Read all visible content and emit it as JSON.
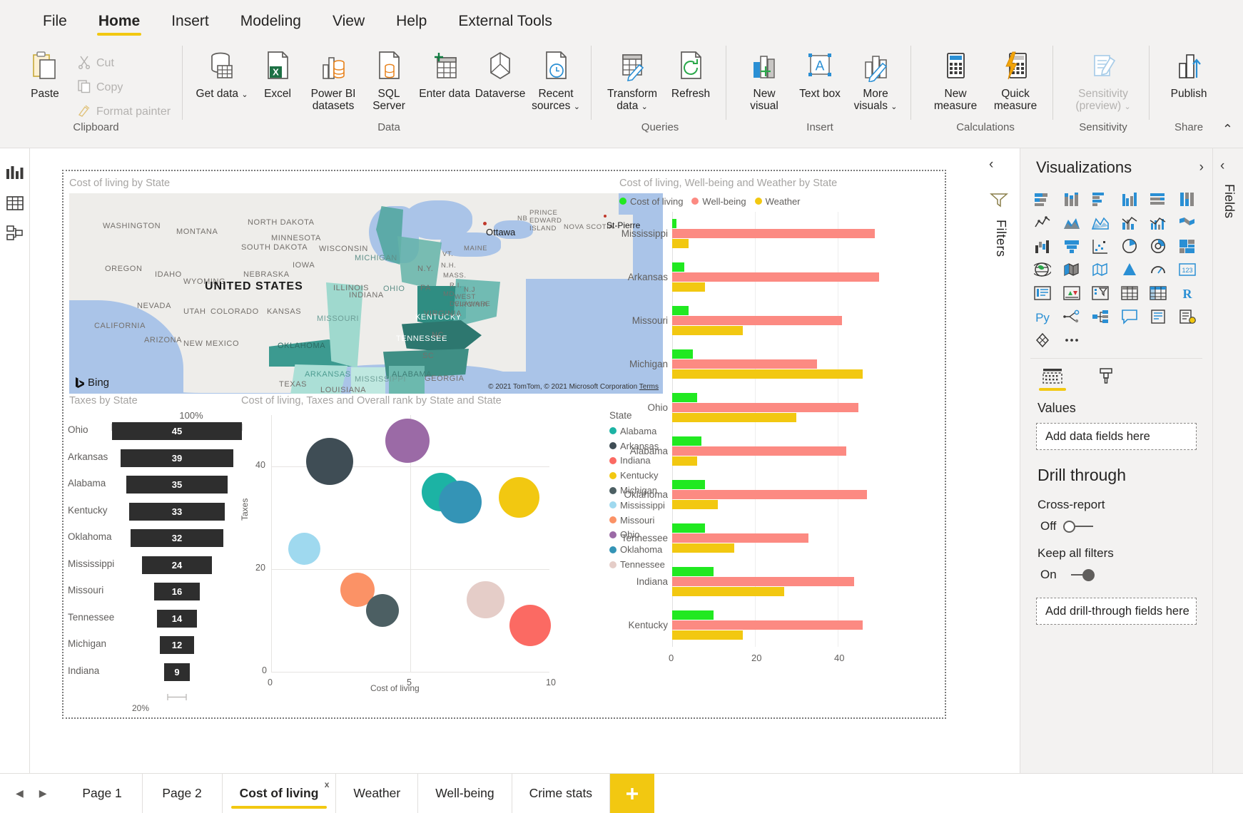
{
  "ribbon": {
    "tabs": [
      {
        "label": "File",
        "active": false
      },
      {
        "label": "Home",
        "active": true
      },
      {
        "label": "Insert",
        "active": false
      },
      {
        "label": "Modeling",
        "active": false
      },
      {
        "label": "View",
        "active": false
      },
      {
        "label": "Help",
        "active": false
      },
      {
        "label": "External Tools",
        "active": false
      }
    ],
    "groups": [
      {
        "name": "Clipboard",
        "items": [
          {
            "label": "Paste",
            "icon": "paste-icon",
            "disabled": false
          },
          {
            "label": "Cut",
            "icon": "cut-icon",
            "disabled": true
          },
          {
            "label": "Copy",
            "icon": "copy-icon",
            "disabled": true
          },
          {
            "label": "Format painter",
            "icon": "format-painter-icon",
            "disabled": true
          }
        ]
      },
      {
        "name": "Data",
        "items": [
          {
            "label": "Get data",
            "icon": "get-data-icon",
            "caret": true
          },
          {
            "label": "Excel",
            "icon": "excel-icon"
          },
          {
            "label": "Power BI datasets",
            "icon": "powerbi-datasets-icon"
          },
          {
            "label": "SQL Server",
            "icon": "sql-server-icon"
          },
          {
            "label": "Enter data",
            "icon": "enter-data-icon"
          },
          {
            "label": "Dataverse",
            "icon": "dataverse-icon"
          },
          {
            "label": "Recent sources",
            "icon": "recent-sources-icon",
            "caret": true
          }
        ]
      },
      {
        "name": "Queries",
        "items": [
          {
            "label": "Transform data",
            "icon": "transform-data-icon",
            "caret": true
          },
          {
            "label": "Refresh",
            "icon": "refresh-icon"
          }
        ]
      },
      {
        "name": "Insert",
        "items": [
          {
            "label": "New visual",
            "icon": "new-visual-icon"
          },
          {
            "label": "Text box",
            "icon": "text-box-icon"
          },
          {
            "label": "More visuals",
            "icon": "more-visuals-icon",
            "caret": true
          }
        ]
      },
      {
        "name": "Calculations",
        "items": [
          {
            "label": "New measure",
            "icon": "new-measure-icon"
          },
          {
            "label": "Quick measure",
            "icon": "quick-measure-icon"
          }
        ]
      },
      {
        "name": "Sensitivity",
        "items": [
          {
            "label": "Sensitivity (preview)",
            "icon": "sensitivity-icon",
            "caret": true,
            "disabled": true
          }
        ]
      },
      {
        "name": "Share",
        "items": [
          {
            "label": "Publish",
            "icon": "publish-icon"
          }
        ]
      }
    ],
    "collapse_icon": "chevron-up-icon"
  },
  "left_rail": [
    {
      "name": "report-view-icon"
    },
    {
      "name": "data-view-icon"
    },
    {
      "name": "model-view-icon"
    }
  ],
  "filters_pane": {
    "label": "Filters",
    "collapse_icon": "chevron-left-icon",
    "filter_icon": "filter-funnel-icon"
  },
  "fields_pane": {
    "label": "Fields",
    "collapse_icon": "chevron-left-icon"
  },
  "visualizations": {
    "title": "Visualizations",
    "collapse_icon": "chevron-right-icon",
    "icons": [
      "stacked-bar-chart-icon",
      "stacked-column-chart-icon",
      "clustered-bar-chart-icon",
      "clustered-column-chart-icon",
      "pct-stacked-bar-icon",
      "pct-stacked-column-icon",
      "line-chart-icon",
      "area-chart-icon",
      "stacked-area-chart-icon",
      "line-stacked-column-icon",
      "line-clustered-column-icon",
      "ribbon-chart-icon",
      "waterfall-chart-icon",
      "funnel-chart-icon",
      "scatter-chart-icon",
      "pie-chart-icon",
      "donut-chart-icon",
      "treemap-icon",
      "map-icon",
      "filled-map-icon",
      "shape-map-icon",
      "azure-map-icon",
      "gauge-icon",
      "card-icon",
      "multi-row-card-icon",
      "kpi-icon",
      "slicer-icon",
      "table-icon",
      "matrix-icon",
      "r-script-visual-icon",
      "python-visual-icon",
      "key-influencers-icon",
      "decomposition-tree-icon",
      "qna-icon",
      "smart-narrative-icon",
      "paginated-report-icon",
      "get-more-visuals-icon",
      "more-options-icon"
    ],
    "field_tabs": [
      {
        "name": "fields-tab-icon",
        "active": true
      },
      {
        "name": "format-paintbrush-tab-icon",
        "active": false
      }
    ],
    "values_label": "Values",
    "values_well_placeholder": "Add data fields here",
    "drill_through": {
      "title": "Drill through",
      "cross_report_label": "Cross-report",
      "cross_report_state": "Off",
      "keep_filters_label": "Keep all filters",
      "keep_filters_state": "On",
      "well_placeholder": "Add drill-through fields here"
    }
  },
  "page_tabs": {
    "prev_icon": "chevron-left-icon",
    "next_icon": "chevron-right-icon",
    "add_icon": "plus-icon",
    "tabs": [
      {
        "label": "Page 1",
        "active": false
      },
      {
        "label": "Page 2",
        "active": false
      },
      {
        "label": "Cost of living",
        "active": true,
        "close": "x"
      },
      {
        "label": "Weather",
        "active": false
      },
      {
        "label": "Well-being",
        "active": false
      },
      {
        "label": "Crime stats",
        "active": false
      }
    ]
  },
  "map_visual": {
    "title": "Cost of living by State",
    "attribution": "© 2021 TomTom, © 2021 Microsoft Corporation",
    "terms_link": "Terms",
    "provider": "Bing",
    "country_label": "UNITED STATES",
    "city_labels": [
      "Ottawa",
      "St-Pierre"
    ],
    "state_labels": [
      "WASHINGTON",
      "MONTANA",
      "NORTH DAKOTA",
      "MINNESOTA",
      "WISCONSIN",
      "MICHIGAN",
      "OREGON",
      "IDAHO",
      "WYOMING",
      "SOUTH DAKOTA",
      "IOWA",
      "NEBRASKA",
      "NEVADA",
      "UTAH",
      "COLORADO",
      "KANSAS",
      "MISSOURI",
      "ILLINOIS",
      "INDIANA",
      "OHIO",
      "PA",
      "N.Y.",
      "MASS.",
      "R.I.",
      "N.H.",
      "VT.",
      "MAINE",
      "CALIFORNIA",
      "ARIZONA",
      "NEW MEXICO",
      "OKLAHOMA",
      "ARKANSAS",
      "KENTUCKY",
      "TENNESSEE",
      "WEST VIRGINIA",
      "VIRGINIA",
      "MD",
      "DELAWARE",
      "N.J.",
      "NC",
      "SC",
      "TEXAS",
      "LOUISIANA",
      "MISSISSIPPI",
      "ALABAMA",
      "GEORGIA",
      "NB",
      "PRINCE EDWARD ISLAND",
      "NOVA SCOTIA"
    ]
  },
  "chart_data": [
    {
      "id": "funnel",
      "type": "bar",
      "title": "Taxes by State",
      "subtype": "funnel",
      "top_label": "100%",
      "bottom_label": "20%",
      "categories": [
        "Ohio",
        "Arkansas",
        "Alabama",
        "Kentucky",
        "Oklahoma",
        "Mississippi",
        "Missouri",
        "Tennessee",
        "Michigan",
        "Indiana"
      ],
      "values": [
        45,
        39,
        35,
        33,
        32,
        24,
        16,
        14,
        12,
        9
      ],
      "ylabel": "",
      "xlabel": "",
      "color": "#2e2e2e"
    },
    {
      "id": "scatter",
      "type": "scatter",
      "title": "Cost of living, Taxes and Overall rank by State and State",
      "xlabel": "Cost of living",
      "ylabel": "Taxes",
      "xlim": [
        0,
        10
      ],
      "ylim": [
        0,
        50
      ],
      "xticks": [
        0,
        5,
        10
      ],
      "yticks": [
        0,
        20,
        40
      ],
      "legend_title": "State",
      "legend_position": "right",
      "points": [
        {
          "name": "Ohio",
          "x": 4.9,
          "y": 45,
          "size": 45,
          "color": "#9b6aa6"
        },
        {
          "name": "Arkansas",
          "x": 2.1,
          "y": 41,
          "size": 50,
          "color": "#3f4d55"
        },
        {
          "name": "Alabama",
          "x": 6.1,
          "y": 35,
          "size": 37,
          "color": "#1cb3a4"
        },
        {
          "name": "Oklahoma",
          "x": 6.8,
          "y": 33,
          "size": 43,
          "color": "#3494b6"
        },
        {
          "name": "Kentucky",
          "x": 8.9,
          "y": 34,
          "size": 40,
          "color": "#f2c811"
        },
        {
          "name": "Mississippi",
          "x": 1.2,
          "y": 24,
          "size": 27,
          "color": "#9fd9ef"
        },
        {
          "name": "Missouri",
          "x": 3.1,
          "y": 16,
          "size": 30,
          "color": "#fb9266"
        },
        {
          "name": "Michigan",
          "x": 4.0,
          "y": 12,
          "size": 28,
          "color": "#4c5f63"
        },
        {
          "name": "Tennessee",
          "x": 7.7,
          "y": 14,
          "size": 35,
          "color": "#e5cdc8"
        },
        {
          "name": "Indiana",
          "x": 9.3,
          "y": 9,
          "size": 41,
          "color": "#fb6a63"
        }
      ],
      "legend": [
        {
          "label": "Alabama",
          "color": "#1cb3a4"
        },
        {
          "label": "Arkansas",
          "color": "#3f4d55"
        },
        {
          "label": "Indiana",
          "color": "#fb6a63"
        },
        {
          "label": "Kentucky",
          "color": "#f2c811"
        },
        {
          "label": "Michigan",
          "color": "#4c5f63"
        },
        {
          "label": "Mississippi",
          "color": "#9fd9ef"
        },
        {
          "label": "Missouri",
          "color": "#fb9266"
        },
        {
          "label": "Ohio",
          "color": "#9b6aa6"
        },
        {
          "label": "Oklahoma",
          "color": "#3494b6"
        },
        {
          "label": "Tennessee",
          "color": "#e5cdc8"
        }
      ]
    },
    {
      "id": "bars",
      "type": "bar",
      "title": "Cost of living, Well-being and Weather by State",
      "orientation": "horizontal",
      "xlabel": "",
      "ylabel": "",
      "xticks": [
        0,
        20,
        40
      ],
      "xlim": [
        0,
        50
      ],
      "categories": [
        "Mississippi",
        "Arkansas",
        "Missouri",
        "Michigan",
        "Ohio",
        "Alabama",
        "Oklahoma",
        "Tennessee",
        "Indiana",
        "Kentucky"
      ],
      "series": [
        {
          "name": "Cost of living",
          "color": "#21e921",
          "values": [
            1,
            3,
            4,
            5,
            6,
            7,
            8,
            8,
            10,
            10
          ]
        },
        {
          "name": "Well-being",
          "color": "#fc8a82",
          "values": [
            49,
            50,
            41,
            35,
            45,
            42,
            47,
            33,
            44,
            46
          ]
        },
        {
          "name": "Weather",
          "color": "#f2c811",
          "values": [
            4,
            8,
            17,
            46,
            30,
            6,
            11,
            15,
            27,
            17
          ]
        }
      ],
      "legend_position": "top"
    }
  ]
}
